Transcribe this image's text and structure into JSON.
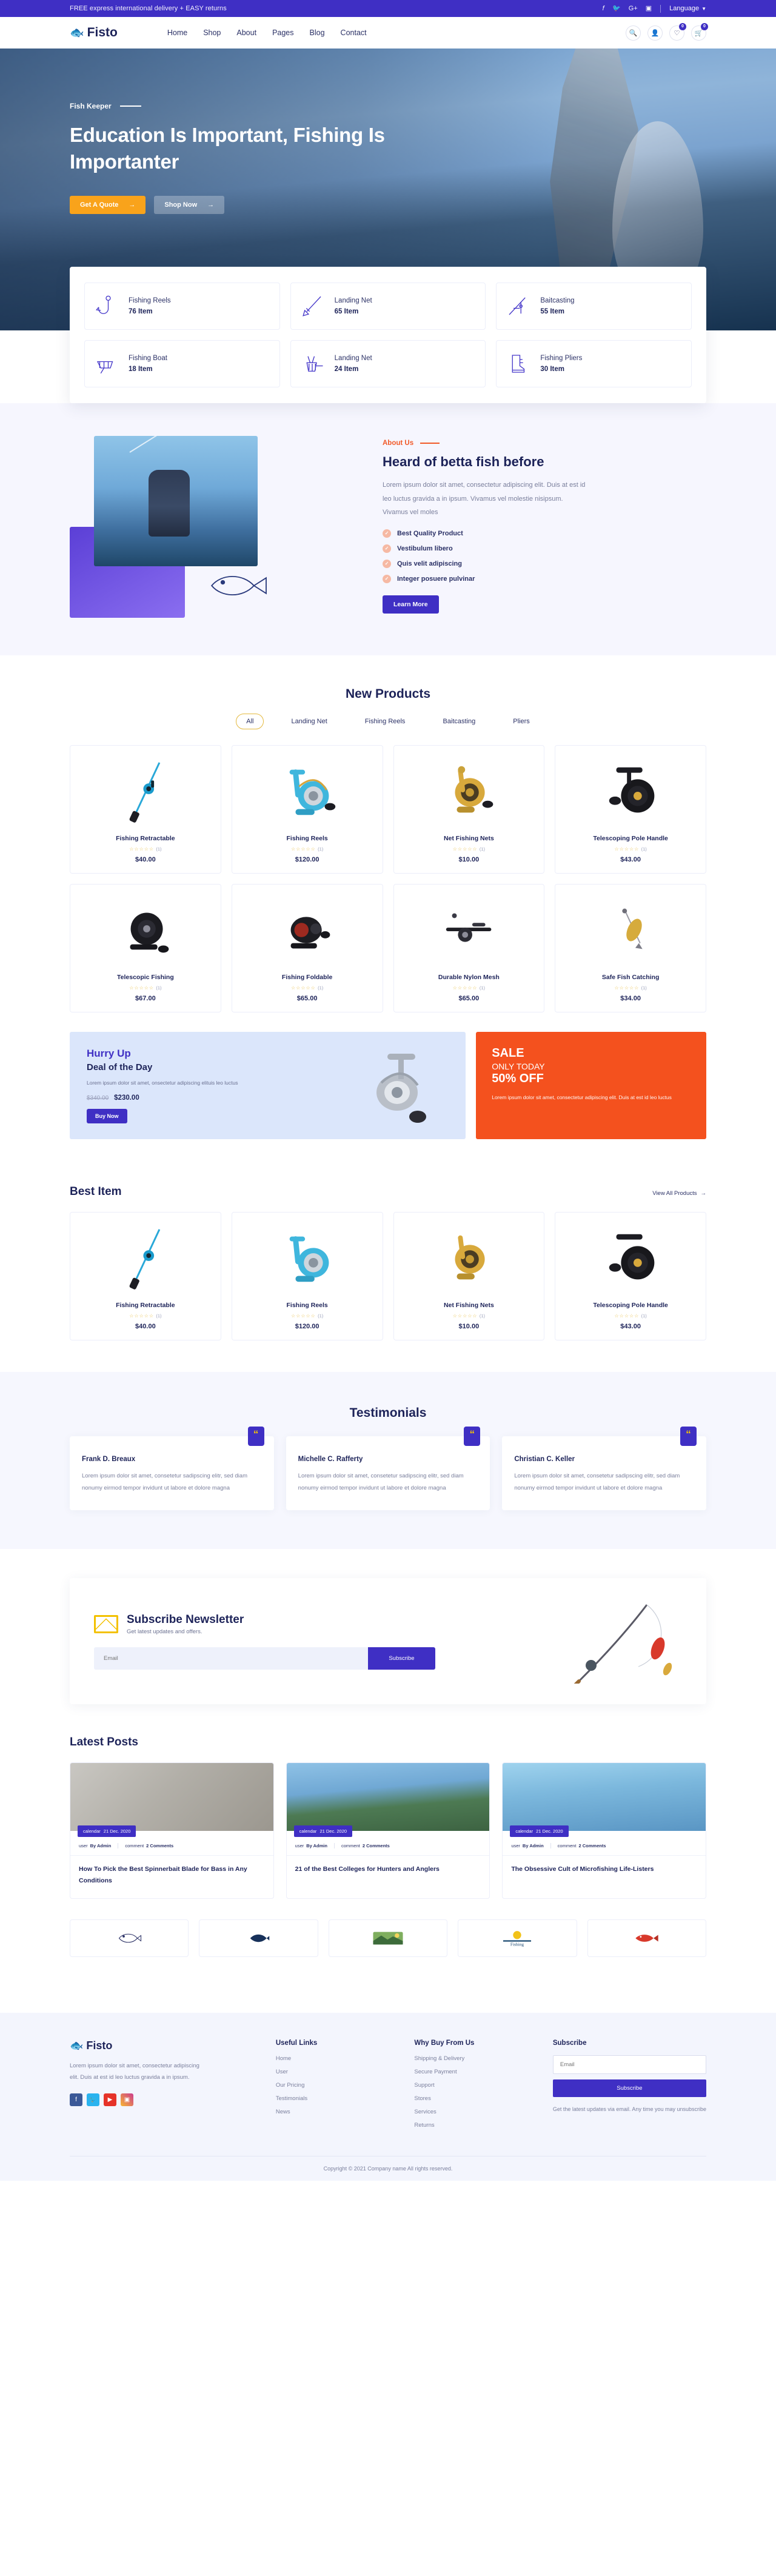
{
  "topbar": {
    "message": "FREE express international delivery + EASY returns",
    "social": [
      "f",
      "t",
      "G+",
      "ig"
    ],
    "language": "Language"
  },
  "header": {
    "brand": "Fisto",
    "nav": [
      "Home",
      "Shop",
      "About",
      "Pages",
      "Blog",
      "Contact"
    ],
    "wishlist_count": "0",
    "cart_count": "0"
  },
  "hero": {
    "eyebrow": "Fish Keeper",
    "title": "Education Is Important, Fishing Is Importanter",
    "btn_primary": "Get A Quote",
    "btn_secondary": "Shop Now"
  },
  "categories": [
    {
      "name": "Fishing Reels",
      "count": "76 Item",
      "icon": "fish-hook-icon"
    },
    {
      "name": "Landing Net",
      "count": "65 Item",
      "icon": "spear-icon"
    },
    {
      "name": "Baitcasting",
      "count": "55 Item",
      "icon": "rod-icon"
    },
    {
      "name": "Fishing Boat",
      "count": "18 Item",
      "icon": "boat-icon"
    },
    {
      "name": "Landing Net",
      "count": "24 Item",
      "icon": "net-icon"
    },
    {
      "name": "Fishing Pliers",
      "count": "30 Item",
      "icon": "boot-icon"
    }
  ],
  "about": {
    "eyebrow": "About Us",
    "heading": "Heard of betta fish before",
    "paragraph": "Lorem ipsum dolor sit amet, consectetur adipiscing elit. Duis at est id leo luctus gravida a in ipsum. Vivamus vel molestie nisipsum. Vivamus vel moles",
    "features": [
      "Best Quality Product",
      "Vestibulum libero",
      "Quis velit adipiscing",
      "Integer posuere pulvinar"
    ],
    "button": "Learn More"
  },
  "new_products": {
    "title": "New Products",
    "tabs": [
      "All",
      "Landing Net",
      "Fishing Reels",
      "Baitcasting",
      "Pliers"
    ],
    "active_tab": "All",
    "items": [
      {
        "name": "Fishing Retractable",
        "rating": "(1)",
        "price": "$40.00",
        "art": "rod-blue"
      },
      {
        "name": "Fishing Reels",
        "rating": "(1)",
        "price": "$120.00",
        "art": "reel-blue"
      },
      {
        "name": "Net Fishing Nets",
        "rating": "(1)",
        "price": "$10.00",
        "art": "reel-gold"
      },
      {
        "name": "Telescoping Pole Handle",
        "rating": "(1)",
        "price": "$43.00",
        "art": "reel-black"
      },
      {
        "name": "Telescopic Fishing",
        "rating": "(1)",
        "price": "$67.00",
        "art": "reel-black"
      },
      {
        "name": "Fishing Foldable",
        "rating": "(1)",
        "price": "$65.00",
        "art": "reel-red"
      },
      {
        "name": "Durable Nylon Mesh",
        "rating": "(1)",
        "price": "$65.00",
        "art": "rod-dark"
      },
      {
        "name": "Safe Fish Catching",
        "rating": "(1)",
        "price": "$34.00",
        "art": "lure-gold"
      }
    ]
  },
  "promo": {
    "blue": {
      "title": "Hurry Up",
      "subtitle": "Deal of the Day",
      "text": "Lorem ipsum dolor sit amet, onsectetur adipiscing elituis leo luctus",
      "price_old": "$340.00",
      "price_new": "$230.00",
      "button": "Buy Now"
    },
    "orange": {
      "line1": "SALE",
      "line2": "ONLY TODAY",
      "line3": "50% OFF",
      "text": "Lorem ipsum dolor sit amet, consectetur adipiscing elit. Duis at est id leo luctus"
    }
  },
  "best_item": {
    "title": "Best Item",
    "view_all": "View All Products",
    "items": [
      {
        "name": "Fishing Retractable",
        "rating": "(1)",
        "price": "$40.00",
        "art": "rod-blue"
      },
      {
        "name": "Fishing Reels",
        "rating": "(1)",
        "price": "$120.00",
        "art": "reel-blue"
      },
      {
        "name": "Net Fishing Nets",
        "rating": "(1)",
        "price": "$10.00",
        "art": "reel-gold"
      },
      {
        "name": "Telescoping Pole Handle",
        "rating": "(1)",
        "price": "$43.00",
        "art": "reel-black"
      }
    ]
  },
  "testimonials": {
    "title": "Testimonials",
    "items": [
      {
        "name": "Frank D. Breaux",
        "text": "Lorem ipsum dolor sit amet, consetetur sadipscing elitr, sed diam nonumy eirmod tempor invidunt ut labore et dolore magna"
      },
      {
        "name": "Michelle C. Rafferty",
        "text": "Lorem ipsum dolor sit amet, consetetur sadipscing elitr, sed diam nonumy eirmod tempor invidunt ut labore et dolore magna"
      },
      {
        "name": "Christian C. Keller",
        "text": "Lorem ipsum dolor sit amet, consetetur sadipscing elitr, sed diam nonumy eirmod tempor invidunt ut labore et dolore magna"
      }
    ]
  },
  "newsletter": {
    "title": "Subscribe Newsletter",
    "subtitle": "Get latest updates and offers.",
    "placeholder": "Email",
    "button": "Subscribe"
  },
  "blog": {
    "title": "Latest Posts",
    "posts": [
      {
        "date": "21 Dec. 2020",
        "author": "By Admin",
        "comments": "2 Comments",
        "title": "How To Pick the Best Spinnerbait Blade for Bass in Any Conditions"
      },
      {
        "date": "21 Dec. 2020",
        "author": "By Admin",
        "comments": "2 Comments",
        "title": "21 of the Best Colleges for Hunters and Anglers"
      },
      {
        "date": "21 Dec. 2020",
        "author": "By Admin",
        "comments": "2 Comments",
        "title": "The Obsessive Cult of Microfishing Life-Listers"
      }
    ],
    "meta_labels": {
      "calendar": "calendar",
      "user": "user",
      "comment": "comment"
    }
  },
  "footer": {
    "brand": "Fisto",
    "about": "Lorem ipsum dolor sit amet, consectetur adipiscing elit. Duis at est id leo luctus gravida a in ipsum.",
    "useful_links_title": "Useful Links",
    "useful_links": [
      "Home",
      "User",
      "Our Pricing",
      "Testimonials",
      "News"
    ],
    "why_title": "Why Buy From Us",
    "why_links": [
      "Shipping & Delivery",
      "Secure Payment",
      "Support",
      "Stores",
      "Services",
      "Returns"
    ],
    "subscribe_title": "Subscribe",
    "subscribe_placeholder": "Email",
    "subscribe_button": "Subscribe",
    "subscribe_note": "Get the latest updates via email. Any time you may unsubscribe",
    "copyright": "Copyright © 2021 Company name All rights reserved."
  },
  "colors": {
    "indigo": "#3f2fc4",
    "amber": "#f9a31b",
    "orange": "#f4511e",
    "navy": "#1d2359",
    "yellow": "#f7c600"
  }
}
